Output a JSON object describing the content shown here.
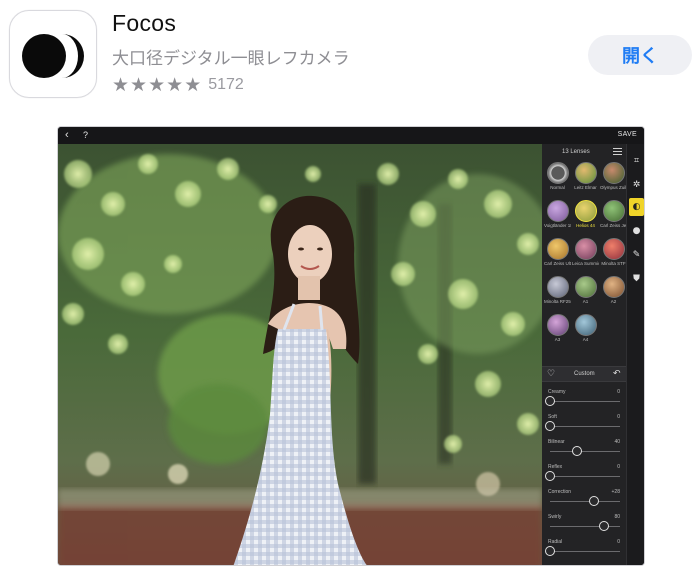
{
  "app": {
    "name": "Focos",
    "subtitle": "大口径デジタル一眼レフカメラ",
    "rating_stars": 5,
    "rating_count": "5172",
    "open_label": "開く",
    "accent_color": "#1f7cf4"
  },
  "preview": {
    "topbar": {
      "back_icon": "chevron-left-icon",
      "help_label": "?",
      "save_label": "SAVE"
    },
    "lens_panel": {
      "count_label": "13 Lenses",
      "lenses": [
        {
          "label": "Normal",
          "active": false
        },
        {
          "label": "Leitz Elmar",
          "active": false
        },
        {
          "label": "Olympus Zuiko",
          "active": false
        },
        {
          "label": "Voigtländer 180",
          "active": false
        },
        {
          "label": "Helios 44",
          "active": true
        },
        {
          "label": "Carl Zeiss Jena",
          "active": false
        },
        {
          "label": "Carl Zeiss Ultra",
          "active": false
        },
        {
          "label": "Leica Summicr",
          "active": false
        },
        {
          "label": "Minolta STF",
          "active": false
        },
        {
          "label": "Minolta RF250",
          "active": false
        },
        {
          "label": "A1",
          "active": false
        },
        {
          "label": "A2",
          "active": false
        },
        {
          "label": "A3",
          "active": false
        },
        {
          "label": "A4",
          "active": false
        }
      ],
      "custom_label": "Custom",
      "sliders": [
        {
          "name": "Creamy",
          "value": "0",
          "level": 0.0
        },
        {
          "name": "Soft",
          "value": "0",
          "level": 0.0
        },
        {
          "name": "Bilinear",
          "value": "40",
          "level": 0.4
        },
        {
          "name": "Reflex",
          "value": "0",
          "level": 0.0
        },
        {
          "name": "Correction",
          "value": "+28",
          "level": 0.64
        },
        {
          "name": "Swirly",
          "value": "80",
          "level": 0.8
        },
        {
          "name": "Radial",
          "value": "0",
          "level": 0.0
        }
      ]
    },
    "tools": [
      "crop-icon",
      "aperture-icon",
      "lens-icon",
      "light-icon",
      "brush-icon",
      "shield-icon"
    ]
  }
}
